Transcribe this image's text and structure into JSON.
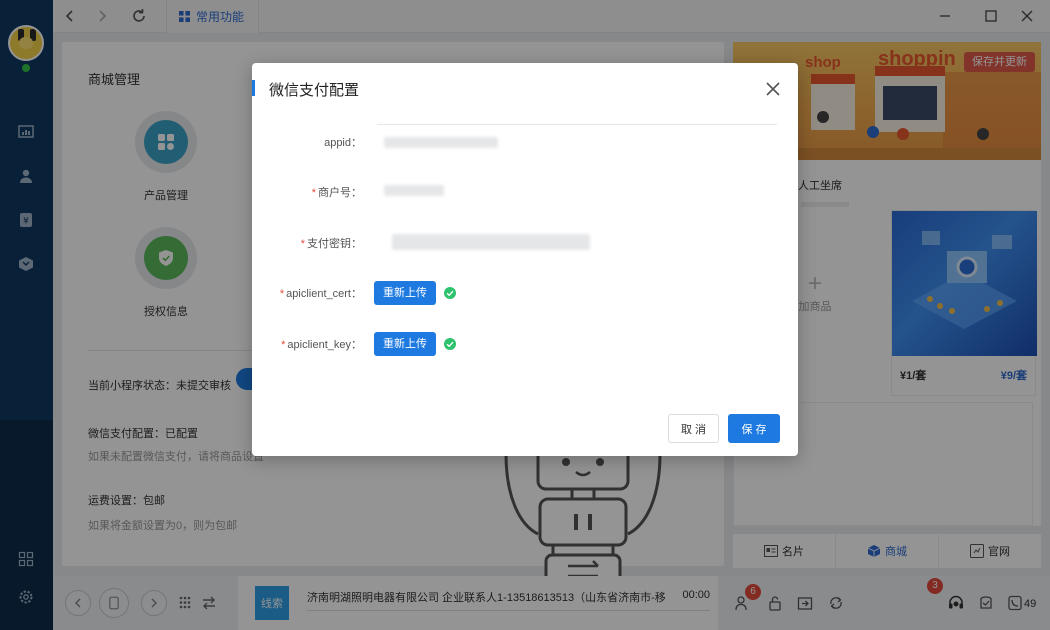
{
  "topbar": {
    "common_tab_label": "常用功能"
  },
  "shop_panel": {
    "title": "商城管理",
    "features": [
      {
        "label": "产品管理"
      },
      {
        "label": "授权信息"
      }
    ],
    "status_line": "当前小程序状态：未提交审核",
    "wechat_pay_line": "微信支付配置：已配置",
    "wechat_pay_hint": "如果未配置微信支付，请将商品设置",
    "shipping_line": "运费设置：包邮",
    "shipping_hint": "如果将金额设置为0，则为包邮"
  },
  "right_panel": {
    "banner_word_small": "shop",
    "banner_word_large": "shoppin",
    "banner_save_label": "保存并更新",
    "shop_caption": "人工坐席",
    "add_product_label": "加商品",
    "price_left": "¥1/套",
    "price_right": "¥9/套",
    "tabs": [
      {
        "label": "名片",
        "icon": "card-icon"
      },
      {
        "label": "商城",
        "icon": "cube-icon"
      },
      {
        "label": "官网",
        "icon": "website-icon"
      }
    ]
  },
  "callbar": {
    "tag_label": "线索",
    "info_text": "济南明湖照明电器有限公司  企业联系人1-13518613513（山东省济南市-移",
    "time": "00:00",
    "badge_left": "6",
    "badge_right": "3",
    "trailing_number": "49"
  },
  "modal": {
    "title": "微信支付配置",
    "fields": [
      {
        "label": "appid：",
        "required": false
      },
      {
        "label": "商户号：",
        "required": true
      },
      {
        "label": "支付密钥：",
        "required": true
      },
      {
        "label": "apiclient_cert：",
        "required": true,
        "button": "重新上传"
      },
      {
        "label": "apiclient_key：",
        "required": true,
        "button": "重新上传"
      }
    ],
    "cancel_label": "取 消",
    "save_label": "保 存"
  },
  "colors": {
    "primary": "#1e7ae0",
    "rail": "#0f3a63",
    "success": "#2dc26b",
    "danger": "#e24b3b"
  }
}
